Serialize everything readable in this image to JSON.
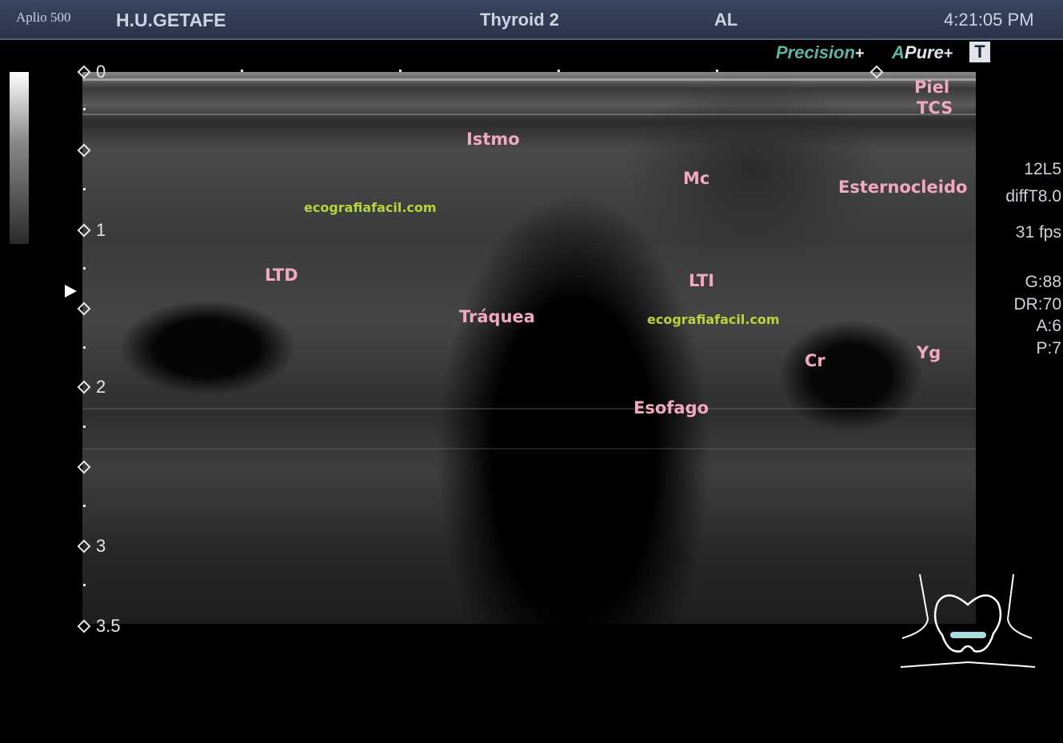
{
  "header": {
    "model": "Aplio 500",
    "hospital": "H.U.GETAFE",
    "preset": "Thyroid 2",
    "user": "AL",
    "time": "4:21:05 PM"
  },
  "branding": {
    "precision": "Precision",
    "apure_a": "A",
    "apure": "Pure",
    "plus": "+",
    "t_icon": "T"
  },
  "depth_scale": {
    "labels": [
      "0",
      "1",
      "2",
      "3",
      "3.5"
    ]
  },
  "parameters": {
    "probe": "12L5",
    "mode": "diffT8.0",
    "frame_rate": "31 fps",
    "gain": "G:88",
    "dynamic_range": "DR:70",
    "a": "A:6",
    "p": "P:7"
  },
  "annotations": {
    "piel": "Piel",
    "tcs": "TCS",
    "istmo": "Istmo",
    "mc": "Mc",
    "esternocleido": "Esternocleido",
    "ltd": "LTD",
    "lti": "LTI",
    "traquea": "Tráquea",
    "esofago": "Esofago",
    "cr": "Cr",
    "yg": "Yg"
  },
  "watermarks": [
    "ecografiafacil.com",
    "ecografiafacil.com"
  ],
  "colors": {
    "header_bg": "#2f3a52",
    "annotation": "#f0a8c4",
    "watermark": "#b5d63a",
    "brand_accent": "#5fb3a4"
  },
  "icons": [
    "grayscale-bar",
    "focus-marker-icon",
    "body-mark-icon"
  ]
}
